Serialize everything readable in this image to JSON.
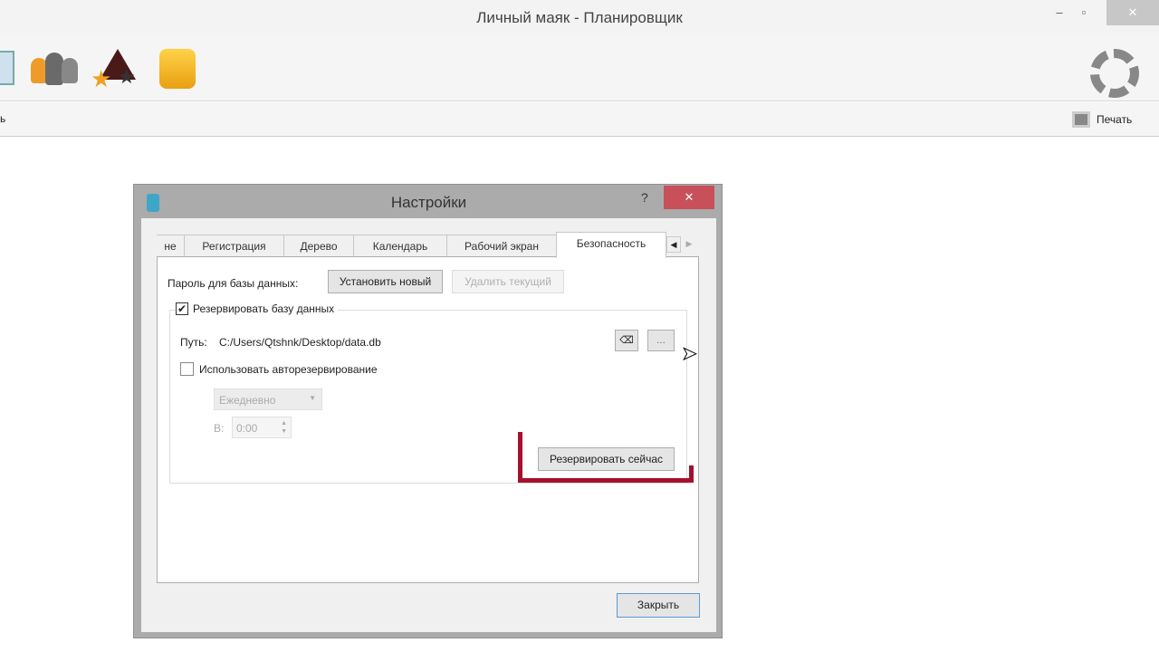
{
  "app": {
    "title": "Личный маяк - Планировщик",
    "toolbar_left_fragment": "ь",
    "print_label": "Печать"
  },
  "dialog": {
    "title": "Настройки",
    "help": "?",
    "close": "✕",
    "tabs": [
      "не",
      "Регистрация",
      "Дерево",
      "Календарь",
      "Рабочий экран",
      "Безопасность"
    ],
    "active_tab": "Безопасность",
    "password_label": "Пароль для базы данных:",
    "set_new": "Установить новый",
    "delete_current": "Удалить текущий",
    "backup_checkbox": "Резервировать базу данных",
    "backup_checked": true,
    "path_label": "Путь:",
    "path_value": "C:/Users/Qtshnk/Desktop/data.db",
    "browse": "...",
    "auto_checkbox": "Использовать авторезервирование",
    "auto_checked": false,
    "frequency": "Ежедневно",
    "at_label": "В:",
    "time": "0:00",
    "backup_now": "Резервировать сейчас",
    "close_button": "Закрыть",
    "highlight_color": "#a5102e"
  }
}
